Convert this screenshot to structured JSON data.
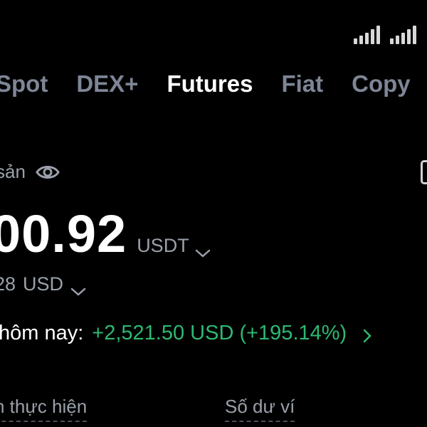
{
  "status_bar": {
    "signal_icons": [
      "signal-bars-icon",
      "signal-bars-icon"
    ]
  },
  "tabs": [
    {
      "label": "Spot",
      "active": false
    },
    {
      "label": "DEX+",
      "active": false
    },
    {
      "label": "Futures",
      "active": true
    },
    {
      "label": "Fiat",
      "active": false
    },
    {
      "label": "Copy",
      "active": false
    }
  ],
  "asset": {
    "label": "sản",
    "visibility_icon": "eye-icon"
  },
  "balance": {
    "value": "00.92",
    "currency": "USDT"
  },
  "usd_balance": {
    "value": "28",
    "currency": "USD"
  },
  "today_pnl": {
    "label": "hôm nay:",
    "value": "+2,521.50 USD (+195.14%)",
    "color": "#2eb872"
  },
  "bottom": {
    "left_label": "n thực hiện",
    "right_label": "Số dư ví"
  },
  "colors": {
    "background": "#000000",
    "muted_text": "#9aa0aa",
    "inactive_tab": "#7d8596",
    "positive": "#2eb872"
  }
}
